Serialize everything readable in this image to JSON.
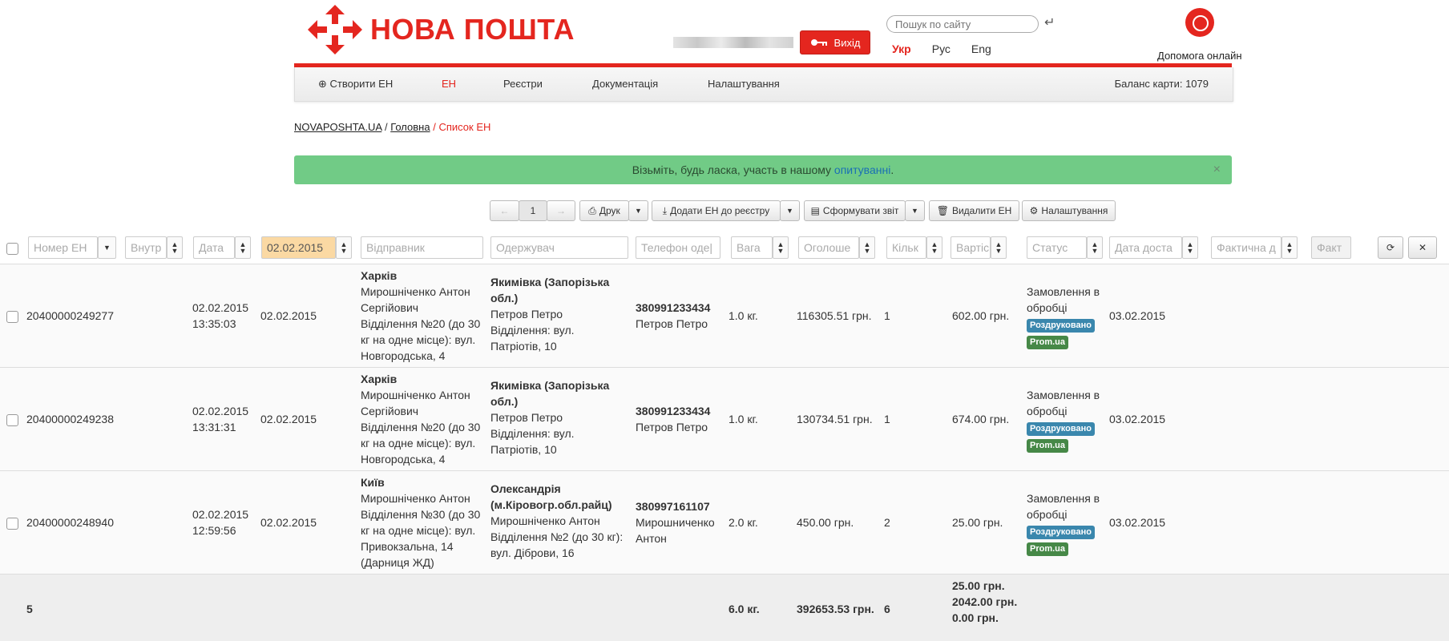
{
  "header": {
    "logo_text": "НОВА ПОШТА",
    "logout_label": "Вихід",
    "search_placeholder": "Пошук по сайту",
    "langs": [
      "Укр",
      "Рус",
      "Eng"
    ],
    "help_label": "Допомога онлайн"
  },
  "nav": {
    "create": "Створити ЕН",
    "en": "ЕН",
    "registers": "Реєстри",
    "docs": "Документація",
    "settings": "Налаштування",
    "balance": "Баланс карти: 1079"
  },
  "breadcrumb": {
    "home": "NOVAPOSHTA.UA",
    "main": "Головна",
    "current": "Список ЕН"
  },
  "alert": {
    "text": "Візьміть, будь ласка, участь в нашому ",
    "link": "опитуванні",
    "tail": ".",
    "close": "×"
  },
  "toolbar": {
    "prev": "←",
    "page": "1",
    "next": "→",
    "print": "Друк",
    "add_register": "Додати ЕН до реєстру",
    "report": "Сформувати звіт",
    "delete": "Видалити ЕН",
    "settings": "Налаштування"
  },
  "filters": {
    "number": "Номер ЕН",
    "internal": "Внутр",
    "date": "Дата",
    "date_value": "02.02.2015",
    "sender": "Відправник",
    "receiver": "Одержувач",
    "phone": "Телефон оде|",
    "weight": "Вага",
    "declared": "Оголоше",
    "count": "Кільк",
    "cost": "Вартіс",
    "status": "Статус",
    "delivery": "Дата доста",
    "actual": "Фактична д",
    "fact": "Факт"
  },
  "rows": [
    {
      "number": "20400000249277",
      "datetime_date": "02.02.2015",
      "datetime_time": "13:35:03",
      "date": "02.02.2015",
      "sender_city": "Харків",
      "sender_name_1": "Мирошніченко Антон",
      "sender_name_2": "Сергійович",
      "sender_addr_1": "Відділення №20 (до 30",
      "sender_addr_2": "кг на одне місце): вул.",
      "sender_addr_3": "Новгородська, 4",
      "receiver_city_1": "Якимівка (Запорізька",
      "receiver_city_2": "обл.)",
      "receiver_name": "Петров Петро",
      "receiver_addr_1": "Відділення: вул.",
      "receiver_addr_2": "Патріотів, 10",
      "phone": "380991233434",
      "phone_name_1": "Петров Петро",
      "phone_name_2": "",
      "weight": "1.0 кг.",
      "declared": "116305.51 грн.",
      "count": "1",
      "cost": "602.00 грн.",
      "status_1": "Замовлення в",
      "status_2": "обробці",
      "badge_printed": "Роздруковано",
      "badge_prom": "Prom.ua",
      "delivery": "03.02.2015"
    },
    {
      "number": "20400000249238",
      "datetime_date": "02.02.2015",
      "datetime_time": "13:31:31",
      "date": "02.02.2015",
      "sender_city": "Харків",
      "sender_name_1": "Мирошніченко Антон",
      "sender_name_2": "Сергійович",
      "sender_addr_1": "Відділення №20 (до 30",
      "sender_addr_2": "кг на одне місце): вул.",
      "sender_addr_3": "Новгородська, 4",
      "receiver_city_1": "Якимівка (Запорізька",
      "receiver_city_2": "обл.)",
      "receiver_name": "Петров Петро",
      "receiver_addr_1": "Відділення: вул.",
      "receiver_addr_2": "Патріотів, 10",
      "phone": "380991233434",
      "phone_name_1": "Петров Петро",
      "phone_name_2": "",
      "weight": "1.0 кг.",
      "declared": "130734.51 грн.",
      "count": "1",
      "cost": "674.00 грн.",
      "status_1": "Замовлення в",
      "status_2": "обробці",
      "badge_printed": "Роздруковано",
      "badge_prom": "Prom.ua",
      "delivery": "03.02.2015"
    },
    {
      "number": "20400000248940",
      "datetime_date": "02.02.2015",
      "datetime_time": "12:59:56",
      "date": "02.02.2015",
      "sender_city": "Київ",
      "sender_name_1": "Мирошніченко Антон",
      "sender_name_2": "Відділення №30 (до 30",
      "sender_addr_1": "кг на одне місце): вул.",
      "sender_addr_2": "Привокзальна, 14",
      "sender_addr_3": "(Дарниця ЖД)",
      "receiver_city_1": "Олександрія",
      "receiver_city_2": "(м.Кіровогр.обл.райц)",
      "receiver_name": "Мирошніченко Антон",
      "receiver_addr_1": "Відділення №2 (до 30 кг):",
      "receiver_addr_2": "вул. Діброви, 16",
      "phone": "380997161107",
      "phone_name_1": "Мирошниченко",
      "phone_name_2": "Антон",
      "weight": "2.0 кг.",
      "declared": "450.00 грн.",
      "count": "2",
      "cost": "25.00 грн.",
      "status_1": "Замовлення в",
      "status_2": "обробці",
      "badge_printed": "Роздруковано",
      "badge_prom": "Prom.ua",
      "delivery": "03.02.2015"
    }
  ],
  "totals": {
    "count": "5",
    "weight": "6.0 кг.",
    "declared": "392653.53 грн.",
    "places": "6",
    "cost_1": "25.00 грн.",
    "cost_2": "2042.00 грн.",
    "cost_3": "0.00 грн."
  },
  "colors": {
    "brand_red": "#e4261f",
    "alert_green": "#71cb86",
    "badge_blue": "#3a87ad",
    "badge_green": "#468847"
  }
}
